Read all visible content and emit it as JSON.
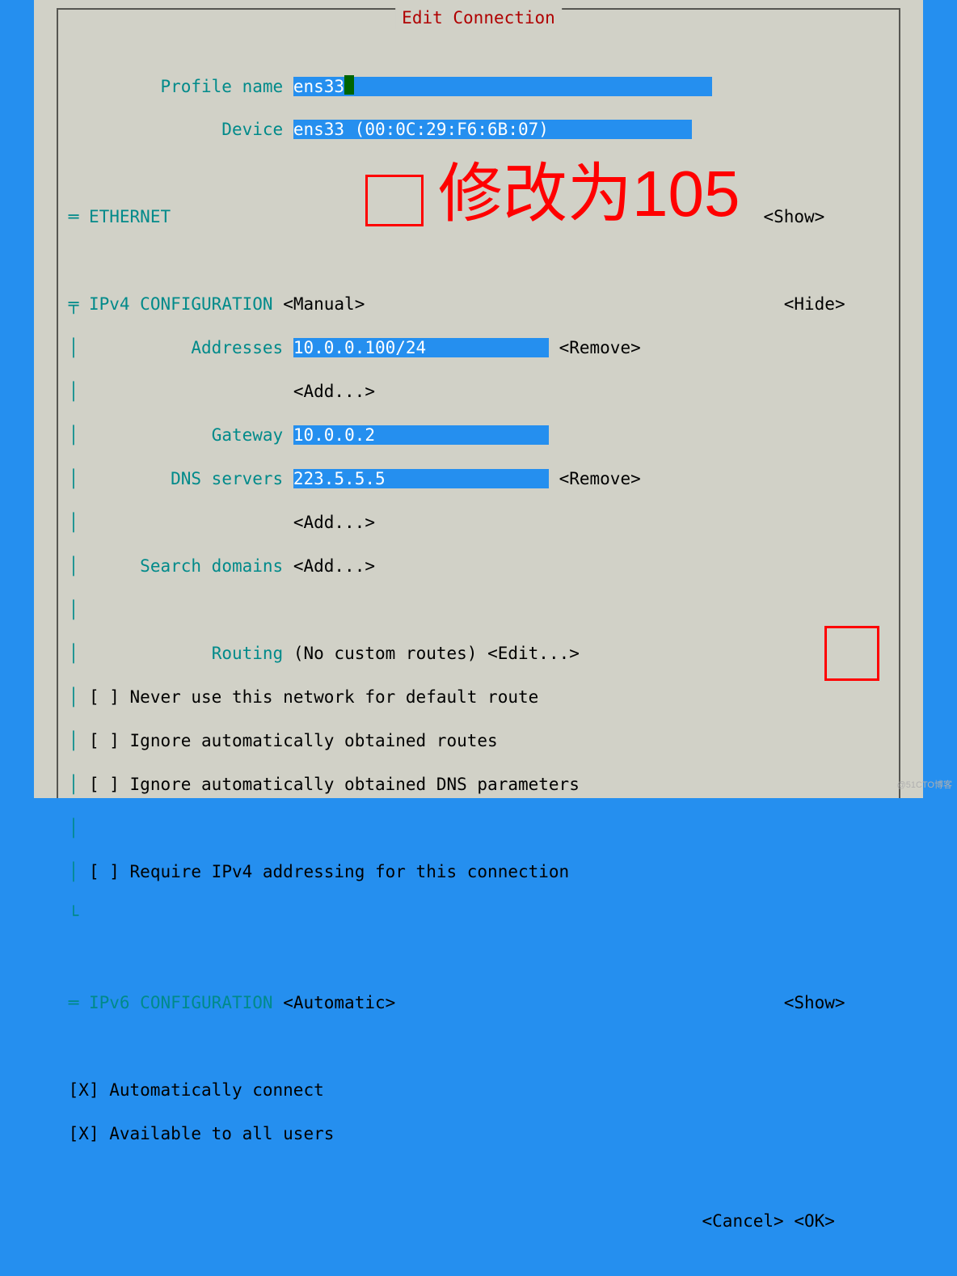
{
  "title": "Edit Connection",
  "profile": {
    "name_label": "Profile name",
    "name_value": "ens33",
    "device_label": "Device",
    "device_value": "ens33 (00:0C:29:F6:6B:07)"
  },
  "ethernet": {
    "header": "ETHERNET",
    "show": "<Show>"
  },
  "ipv4": {
    "header": "IPv4 CONFIGURATION",
    "mode": "<Manual>",
    "hide": "<Hide>",
    "addr_label": "Addresses",
    "addr_value": "10.0.0.100/24",
    "addr_remove": "<Remove>",
    "add": "<Add...>",
    "gw_label": "Gateway",
    "gw_value": "10.0.0.2",
    "dns_label": "DNS servers",
    "dns_value": "223.5.5.5",
    "dns_remove": "<Remove>",
    "search_label": "Search domains",
    "routing_label": "Routing",
    "routing_value": "(No custom routes)",
    "routing_edit": "<Edit...>",
    "chk1": "[ ] Never use this network for default route",
    "chk2": "[ ] Ignore automatically obtained routes",
    "chk3": "[ ] Ignore automatically obtained DNS parameters",
    "chk4": "[ ] Require IPv4 addressing for this connection"
  },
  "ipv6": {
    "header": "IPv6 CONFIGURATION",
    "mode": "<Automatic>",
    "show": "<Show>"
  },
  "auto": {
    "connect": "[X] Automatically connect",
    "avail": "[X] Available to all users"
  },
  "buttons": {
    "cancel": "<Cancel>",
    "ok": "<OK>"
  },
  "annotation": {
    "text": "修改为105"
  },
  "watermark": "@51CTO博客"
}
